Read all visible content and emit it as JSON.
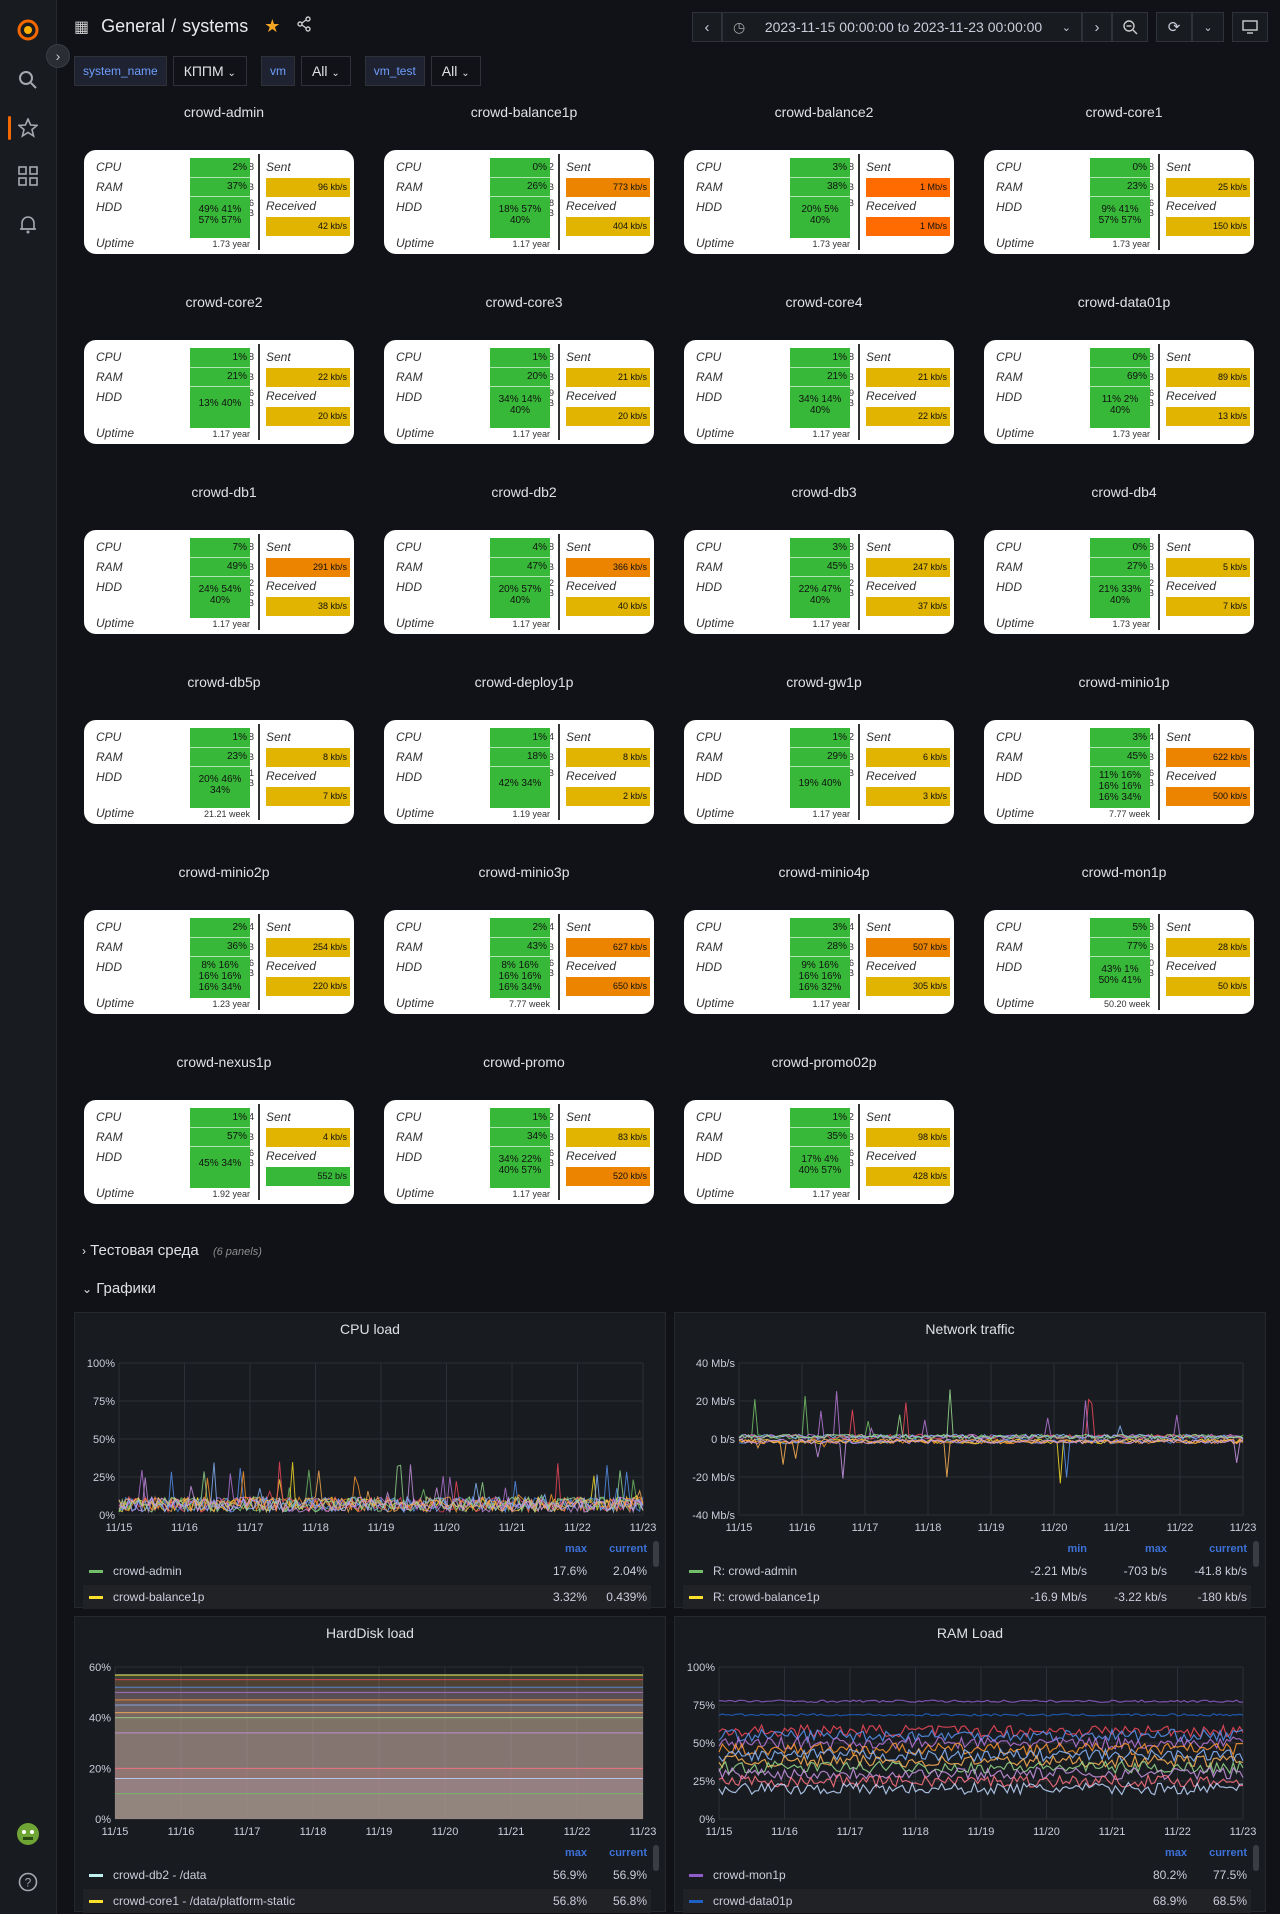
{
  "nav": {
    "breadcrumb_root": "General",
    "breadcrumb_sep": "/",
    "breadcrumb_page": "systems",
    "time_range": "2023-11-15 00:00:00 to 2023-11-23 00:00:00"
  },
  "vars": [
    {
      "label": "system_name",
      "value": "КППМ"
    },
    {
      "label": "vm",
      "value": "All"
    },
    {
      "label": "vm_test",
      "value": "All"
    }
  ],
  "card_labels": {
    "cpu": "CPU",
    "ram": "RAM",
    "hdd": "HDD",
    "uptime": "Uptime",
    "sent": "Sent",
    "received": "Received"
  },
  "colors": {
    "green": "#37b838",
    "yellow": "#e0b400",
    "orange": "#ec8400",
    "red_orange": "#ff6b00"
  },
  "systems": [
    {
      "name": "crowd-admin",
      "cpu_n": "8",
      "ram": "12 GiB",
      "hdd": [
        "816",
        "GiB"
      ],
      "cpu": "2%",
      "ram_p": "37%",
      "hdd_p": [
        "49% 41%",
        "57% 57%"
      ],
      "sent": "96 kb/s",
      "sent_c": "yellow",
      "recv": "42 kb/s",
      "recv_c": "yellow",
      "uptime": "1.73 year"
    },
    {
      "name": "crowd-balance1p",
      "cpu_n": "12",
      "ram": "8 GiB",
      "hdd": [
        "408",
        "GiB"
      ],
      "cpu": "0%",
      "ram_p": "26%",
      "hdd_p": [
        "18% 57%",
        "40%"
      ],
      "sent": "773 kb/s",
      "sent_c": "orange",
      "recv": "404 kb/s",
      "recv_c": "yellow",
      "uptime": "1.17 year"
    },
    {
      "name": "crowd-balance2",
      "cpu_n": "8",
      "ram": "10 GiB",
      "hdd": [
        "60 GiB"
      ],
      "cpu": "3%",
      "ram_p": "38%",
      "hdd_p": [
        "20% 5%",
        "40%"
      ],
      "sent": "1 Mb/s",
      "sent_c": "red_orange",
      "recv": "1 Mb/s",
      "recv_c": "red_orange",
      "uptime": "1.73 year"
    },
    {
      "name": "crowd-core1",
      "cpu_n": "8",
      "ram": "15 GiB",
      "hdd": [
        "916",
        "GiB"
      ],
      "cpu": "0%",
      "ram_p": "23%",
      "hdd_p": [
        "9% 41%",
        "57% 57%"
      ],
      "sent": "25 kb/s",
      "sent_c": "yellow",
      "recv": "150 kb/s",
      "recv_c": "yellow",
      "uptime": "1.73 year"
    },
    {
      "name": "crowd-core2",
      "cpu_n": "8",
      "ram": "15 GiB",
      "hdd": [
        "196",
        "GiB"
      ],
      "cpu": "1%",
      "ram_p": "21%",
      "hdd_p": [
        "13% 40%"
      ],
      "sent": "22 kb/s",
      "sent_c": "yellow",
      "recv": "20 kb/s",
      "recv_c": "yellow",
      "uptime": "1.17 year"
    },
    {
      "name": "crowd-core3",
      "cpu_n": "8",
      "ram": "15 GiB",
      "hdd": [
        "119",
        "GiB"
      ],
      "cpu": "1%",
      "ram_p": "20%",
      "hdd_p": [
        "34% 14%",
        "40%"
      ],
      "sent": "21 kb/s",
      "sent_c": "yellow",
      "recv": "20 kb/s",
      "recv_c": "yellow",
      "uptime": "1.17 year"
    },
    {
      "name": "crowd-core4",
      "cpu_n": "8",
      "ram": "15 GiB",
      "hdd": [
        "119",
        "GiB"
      ],
      "cpu": "1%",
      "ram_p": "21%",
      "hdd_p": [
        "34% 14%",
        "40%"
      ],
      "sent": "21 kb/s",
      "sent_c": "yellow",
      "recv": "22 kb/s",
      "recv_c": "yellow",
      "uptime": "1.17 year"
    },
    {
      "name": "crowd-data01p",
      "cpu_n": "8",
      "ram": "8 GiB",
      "hdd": [
        "146",
        "GiB"
      ],
      "cpu": "0%",
      "ram_p": "69%",
      "hdd_p": [
        "11% 2%",
        "40%"
      ],
      "sent": "89 kb/s",
      "sent_c": "yellow",
      "recv": "13 kb/s",
      "recv_c": "yellow",
      "uptime": "1.73 year"
    },
    {
      "name": "crowd-db1",
      "cpu_n": "8",
      "ram": "15 GiB",
      "hdd": [
        "512",
        "196",
        "GiB"
      ],
      "cpu": "7%",
      "ram_p": "49%",
      "hdd_p": [
        "24% 54%",
        "40%"
      ],
      "sent": "291 kb/s",
      "sent_c": "orange",
      "recv": "38 kb/s",
      "recv_c": "yellow",
      "uptime": "1.17 year"
    },
    {
      "name": "crowd-db2",
      "cpu_n": "8",
      "ram": "15 GiB",
      "hdd": [
        "512",
        "GiB"
      ],
      "cpu": "4%",
      "ram_p": "47%",
      "hdd_p": [
        "20% 57%",
        "40%"
      ],
      "sent": "366 kb/s",
      "sent_c": "orange",
      "recv": "40 kb/s",
      "recv_c": "yellow",
      "uptime": "1.17 year"
    },
    {
      "name": "crowd-db3",
      "cpu_n": "8",
      "ram": "15 GiB",
      "hdd": [
        "512",
        "GiB"
      ],
      "cpu": "3%",
      "ram_p": "45%",
      "hdd_p": [
        "22% 47%",
        "40%"
      ],
      "sent": "247 kb/s",
      "sent_c": "yellow",
      "recv": "37 kb/s",
      "recv_c": "yellow",
      "uptime": "1.17 year"
    },
    {
      "name": "crowd-db4",
      "cpu_n": "8",
      "ram": "15 GiB",
      "hdd": [
        "512",
        "GiB"
      ],
      "cpu": "0%",
      "ram_p": "27%",
      "hdd_p": [
        "21% 33%",
        "40%"
      ],
      "sent": "5 kb/s",
      "sent_c": "yellow",
      "recv": "7 kb/s",
      "recv_c": "yellow",
      "uptime": "1.73 year"
    },
    {
      "name": "crowd-db5p",
      "cpu_n": "8",
      "ram": "15 GiB",
      "hdd": [
        "321",
        "GiB"
      ],
      "cpu": "1%",
      "ram_p": "23%",
      "hdd_p": [
        "20% 46%",
        "34%"
      ],
      "sent": "8 kb/s",
      "sent_c": "yellow",
      "recv": "7 kb/s",
      "recv_c": "yellow",
      "uptime": "21.21 week"
    },
    {
      "name": "crowd-deploy1p",
      "cpu_n": "4",
      "ram": "8 GiB",
      "hdd": [
        "96 GiB"
      ],
      "cpu": "1%",
      "ram_p": "18%",
      "hdd_p": [
        "42% 34%"
      ],
      "sent": "8 kb/s",
      "sent_c": "yellow",
      "recv": "2 kb/s",
      "recv_c": "yellow",
      "uptime": "1.19 year"
    },
    {
      "name": "crowd-gw1p",
      "cpu_n": "2",
      "ram": "2 GiB",
      "hdd": [
        "46 GiB"
      ],
      "cpu": "1%",
      "ram_p": "29%",
      "hdd_p": [
        "19% 40%"
      ],
      "sent": "6 kb/s",
      "sent_c": "yellow",
      "recv": "3 kb/s",
      "recv_c": "yellow",
      "uptime": "1.17 year"
    },
    {
      "name": "crowd-minio1p",
      "cpu_n": "4",
      "ram": "8 GiB",
      "hdd": [
        "246",
        "GiB"
      ],
      "cpu": "3%",
      "ram_p": "45%",
      "hdd_p": [
        "11% 16%",
        "16% 16%",
        "16% 34%"
      ],
      "sent": "622 kb/s",
      "sent_c": "orange",
      "recv": "500 kb/s",
      "recv_c": "orange",
      "uptime": "7.77 week"
    },
    {
      "name": "crowd-minio2p",
      "cpu_n": "4",
      "ram": "8 GiB",
      "hdd": [
        "246",
        "GiB"
      ],
      "cpu": "2%",
      "ram_p": "36%",
      "hdd_p": [
        "8% 16%",
        "16% 16%",
        "16% 34%"
      ],
      "sent": "254 kb/s",
      "sent_c": "yellow",
      "recv": "220 kb/s",
      "recv_c": "yellow",
      "uptime": "1.23 year"
    },
    {
      "name": "crowd-minio3p",
      "cpu_n": "4",
      "ram": "8 GiB",
      "hdd": [
        "246",
        "GiB"
      ],
      "cpu": "2%",
      "ram_p": "43%",
      "hdd_p": [
        "8% 16%",
        "16% 16%",
        "16% 34%"
      ],
      "sent": "627 kb/s",
      "sent_c": "orange",
      "recv": "650 kb/s",
      "recv_c": "orange",
      "uptime": "7.77 week"
    },
    {
      "name": "crowd-minio4p",
      "cpu_n": "4",
      "ram": "8 GiB",
      "hdd": [
        "246",
        "GiB"
      ],
      "cpu": "3%",
      "ram_p": "28%",
      "hdd_p": [
        "9% 16%",
        "16% 16%",
        "16% 32%"
      ],
      "sent": "507 kb/s",
      "sent_c": "orange",
      "recv": "305 kb/s",
      "recv_c": "yellow",
      "uptime": "1.17 year"
    },
    {
      "name": "crowd-mon1p",
      "cpu_n": "8",
      "ram": "15 GiB",
      "hdd": [
        "550",
        "GiB"
      ],
      "cpu": "5%",
      "ram_p": "77%",
      "hdd_p": [
        "43% 1%",
        "50% 41%"
      ],
      "sent": "28 kb/s",
      "sent_c": "yellow",
      "recv": "50 kb/s",
      "recv_c": "yellow",
      "uptime": "50.20 week"
    },
    {
      "name": "crowd-nexus1p",
      "cpu_n": "4",
      "ram": "8 GiB",
      "hdd": [
        "196",
        "GiB"
      ],
      "cpu": "1%",
      "ram_p": "57%",
      "hdd_p": [
        "45% 34%"
      ],
      "sent": "4 kb/s",
      "sent_c": "yellow",
      "recv": "552 b/s",
      "recv_c": "green",
      "uptime": "1.92 year"
    },
    {
      "name": "crowd-promo",
      "cpu_n": "12",
      "ram": "12 GiB",
      "hdd": [
        "456",
        "GiB"
      ],
      "cpu": "1%",
      "ram_p": "34%",
      "hdd_p": [
        "34% 22%",
        "40% 57%"
      ],
      "sent": "83 kb/s",
      "sent_c": "yellow",
      "recv": "520 kb/s",
      "recv_c": "orange",
      "uptime": "1.17 year"
    },
    {
      "name": "crowd-promo02p",
      "cpu_n": "12",
      "ram": "12 GiB",
      "hdd": [
        "726",
        "GiB"
      ],
      "cpu": "1%",
      "ram_p": "35%",
      "hdd_p": [
        "17% 4%",
        "40% 57%"
      ],
      "sent": "98 kb/s",
      "sent_c": "yellow",
      "recv": "428 kb/s",
      "recv_c": "yellow",
      "uptime": "1.17 year"
    }
  ],
  "rows": {
    "test_env": {
      "title": "Тестовая среда",
      "sub": "(6 panels)"
    },
    "graphs": {
      "title": "Графики"
    }
  },
  "chart_data": [
    {
      "type": "line",
      "title": "CPU load",
      "x_ticks": [
        "11/15",
        "11/16",
        "11/17",
        "11/18",
        "11/19",
        "11/20",
        "11/21",
        "11/22",
        "11/23"
      ],
      "y_ticks": [
        "100%",
        "75%",
        "50%",
        "25%",
        "0%"
      ],
      "ylim": [
        0,
        100
      ],
      "legend_headers": [
        "max",
        "current"
      ],
      "series": [
        {
          "name": "crowd-admin",
          "color": "#73bf69",
          "values": [
            "17.6%",
            "2.04%"
          ]
        },
        {
          "name": "crowd-balance1p",
          "color": "#fade2a",
          "values": [
            "3.32%",
            "0.439%"
          ]
        }
      ]
    },
    {
      "type": "line",
      "title": "Network traffic",
      "x_ticks": [
        "11/15",
        "11/16",
        "11/17",
        "11/18",
        "11/19",
        "11/20",
        "11/21",
        "11/22",
        "11/23"
      ],
      "y_ticks": [
        "40 Mb/s",
        "20 Mb/s",
        "0 b/s",
        "-20 Mb/s",
        "-40 Mb/s"
      ],
      "ylim": [
        -40,
        40
      ],
      "legend_headers": [
        "min",
        "max",
        "current"
      ],
      "series": [
        {
          "name": "R: crowd-admin",
          "color": "#73bf69",
          "values": [
            "-2.21 Mb/s",
            "-703 b/s",
            "-41.8 kb/s"
          ]
        },
        {
          "name": "R: crowd-balance1p",
          "color": "#fade2a",
          "values": [
            "-16.9 Mb/s",
            "-3.22 kb/s",
            "-180 kb/s"
          ]
        }
      ]
    },
    {
      "type": "area",
      "title": "HardDisk load",
      "x_ticks": [
        "11/15",
        "11/16",
        "11/17",
        "11/18",
        "11/19",
        "11/20",
        "11/21",
        "11/22",
        "11/23"
      ],
      "y_ticks": [
        "60%",
        "40%",
        "20%",
        "0%"
      ],
      "ylim": [
        0,
        60
      ],
      "legend_headers": [
        "max",
        "current"
      ],
      "series": [
        {
          "name": "crowd-db2 - /data",
          "color": "#c0f0f0",
          "values": [
            "56.9%",
            "56.9%"
          ]
        },
        {
          "name": "crowd-core1 - /data/platform-static",
          "color": "#fade2a",
          "values": [
            "56.8%",
            "56.8%"
          ]
        }
      ]
    },
    {
      "type": "line",
      "title": "RAM Load",
      "x_ticks": [
        "11/15",
        "11/16",
        "11/17",
        "11/18",
        "11/19",
        "11/20",
        "11/21",
        "11/22",
        "11/23"
      ],
      "y_ticks": [
        "100%",
        "75%",
        "50%",
        "25%",
        "0%"
      ],
      "ylim": [
        0,
        100
      ],
      "legend_headers": [
        "max",
        "current"
      ],
      "series": [
        {
          "name": "crowd-mon1p",
          "color": "#8f5cc9",
          "values": [
            "80.2%",
            "77.5%"
          ]
        },
        {
          "name": "crowd-data01p",
          "color": "#1f60c4",
          "values": [
            "68.9%",
            "68.5%"
          ]
        }
      ]
    }
  ]
}
